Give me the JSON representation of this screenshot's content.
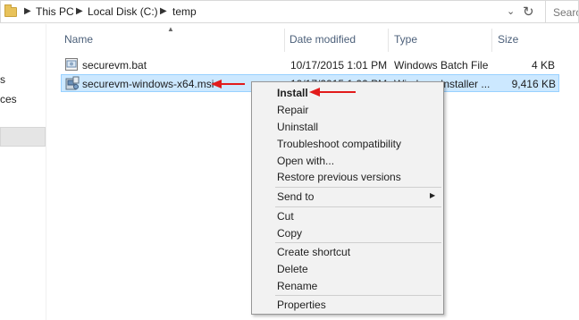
{
  "address_bar": {
    "crumbs": [
      "This PC",
      "Local Disk (C:)",
      "temp"
    ],
    "search_placeholder": "Search"
  },
  "nav_pane": {
    "items": [
      "s",
      "ces"
    ]
  },
  "columns": {
    "name": "Name",
    "date_modified": "Date modified",
    "type": "Type",
    "size": "Size"
  },
  "files": [
    {
      "name": "securevm.bat",
      "date": "10/17/2015 1:01 PM",
      "type": "Windows Batch File",
      "size": "4 KB",
      "icon": "batch-file-icon",
      "selected": false
    },
    {
      "name": "securevm-windows-x64.msi",
      "date": "10/17/2015 1:00 PM",
      "type": "Windows Installer ...",
      "size": "9,416 KB",
      "icon": "msi-installer-icon",
      "selected": true
    }
  ],
  "context_menu": {
    "items": [
      {
        "label": "Install",
        "bold": true
      },
      {
        "label": "Repair"
      },
      {
        "label": "Uninstall"
      },
      {
        "label": "Troubleshoot compatibility"
      },
      {
        "label": "Open with..."
      },
      {
        "label": "Restore previous versions"
      },
      {
        "label": "Send to",
        "submenu": true
      },
      {
        "label": "Cut"
      },
      {
        "label": "Copy"
      },
      {
        "label": "Create shortcut"
      },
      {
        "label": "Delete"
      },
      {
        "label": "Rename"
      },
      {
        "label": "Properties"
      }
    ]
  },
  "colors": {
    "selection_bg": "#cce8ff",
    "selection_border": "#99d1ff",
    "annotation_arrow": "#e21b1b",
    "header_text": "#4c607a"
  }
}
